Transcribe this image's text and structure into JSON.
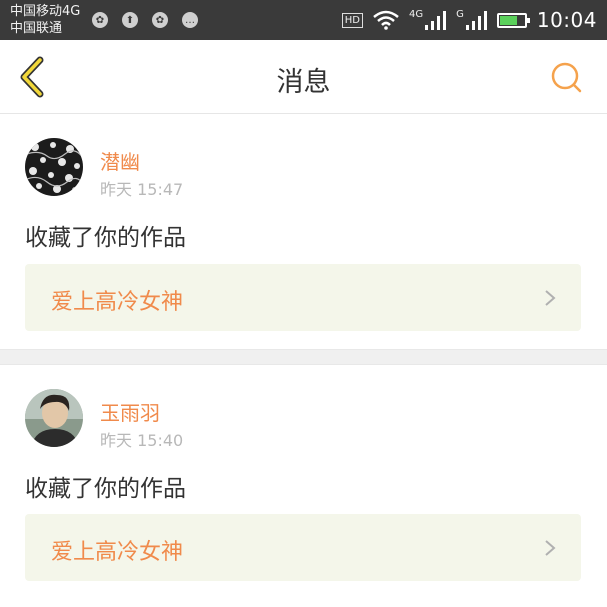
{
  "status_bar": {
    "carrier1": "中国移动4G",
    "carrier2": "中国联通",
    "hd": "HD",
    "net1": "4G",
    "net2": "G",
    "time": "10:04",
    "icons": [
      "notification-icon",
      "notification-icon",
      "notification-icon",
      "chat-icon"
    ]
  },
  "header": {
    "title": "消息",
    "back_icon": "chevron-left-icon",
    "search_icon": "search-icon",
    "accent_color": "#f5a24c"
  },
  "messages": [
    {
      "username": "潜幽",
      "time": "昨天 15:47",
      "action": "收藏了你的作品",
      "work_title": "爱上高冷女神"
    },
    {
      "username": "玉雨羽",
      "time": "昨天 15:40",
      "action": "收藏了你的作品",
      "work_title": "爱上高冷女神"
    }
  ],
  "colors": {
    "name": "#f08a4b",
    "work_bg": "#f4f6ea",
    "divider": "#f0f0f0"
  }
}
